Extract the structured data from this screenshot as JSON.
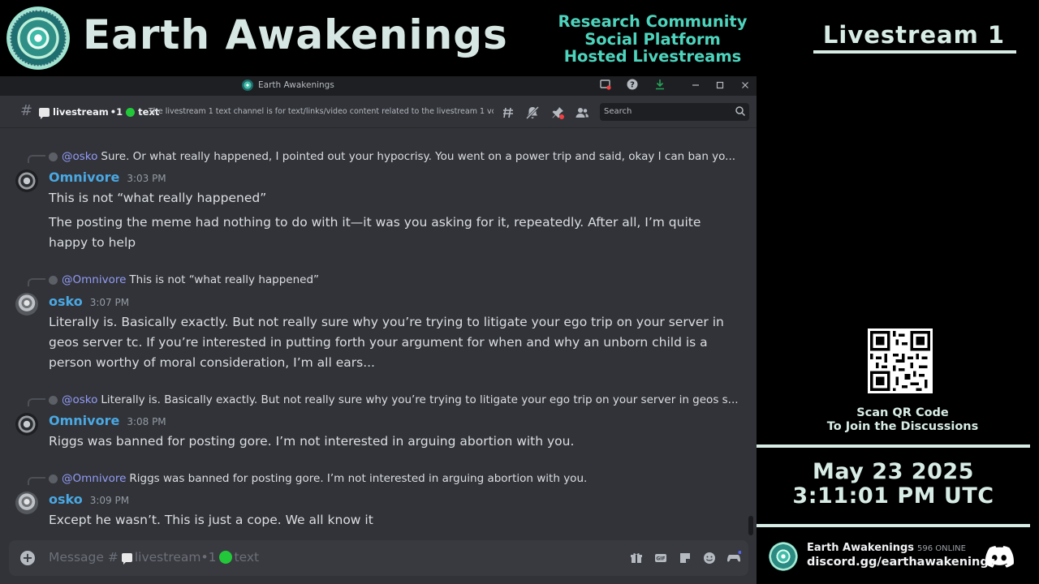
{
  "banner": {
    "title": "Earth Awakenings",
    "tagline_lines": [
      "Research Community",
      "Social Platform",
      "Hosted Livestreams"
    ]
  },
  "side": {
    "title": "Livestream 1",
    "qr_caption_1": "Scan QR Code",
    "qr_caption_2": "To Join the Discussions",
    "date": "May 23 2025",
    "time": "3:11:01 PM UTC",
    "server_name": "Earth Awakenings",
    "server_online": "596 ONLINE",
    "invite": "discord.gg/earthawakenings"
  },
  "window": {
    "title": "Earth Awakenings",
    "channel": {
      "name_prefix": "livestream",
      "name_sep": "•1",
      "name_suffix": "text",
      "topic": "The livestream 1 text channel is for text/links/video content related to the livestream 1 voic..."
    },
    "search_placeholder": "Search",
    "composer": {
      "placeholder_prefix": "Message #",
      "channel_prefix": "livestream",
      "channel_sep": "•1",
      "channel_suffix": "text"
    }
  },
  "messages": [
    {
      "reply_to": "@osko",
      "reply_text": "Sure. Or what really happened, I pointed out your hypocrisy. You went on a power trip and said, okay I can ban yo...",
      "author": "Omnivore",
      "time": "3:03 PM",
      "lines": [
        "This is not “what really happened”",
        "The posting the meme had nothing to do with it—it was you asking for it, repeatedly. After all, I’m quite happy to help"
      ]
    },
    {
      "reply_to": "@Omnivore",
      "reply_text": "This is not “what really happened”",
      "author": "osko",
      "time": "3:07 PM",
      "lines": [
        "Literally is. Basically exactly. But not really sure why you’re trying to litigate your ego trip on your server in geos server tc. If you’re interested in putting forth your argument for when and why an unborn child is a person worthy of moral consideration, I’m all ears..."
      ]
    },
    {
      "reply_to": "@osko",
      "reply_text": "Literally is. Basically exactly. But not really sure why you’re trying to litigate your ego trip on your server in geos s...",
      "author": "Omnivore",
      "time": "3:08 PM",
      "lines": [
        "Riggs was banned for posting gore. I’m not interested in arguing abortion with you."
      ]
    },
    {
      "reply_to": "@Omnivore",
      "reply_text": "Riggs was banned for posting gore. I’m not interested in arguing abortion with you.",
      "author": "osko",
      "time": "3:09 PM",
      "lines": [
        "Except he wasn’t. This is just a cope. We all know it"
      ]
    }
  ],
  "colors": {
    "accent_teal": "#4dd4bd",
    "author_blue": "#4aa8e3",
    "mention": "#949cf7",
    "status_green": "#23c83a"
  }
}
